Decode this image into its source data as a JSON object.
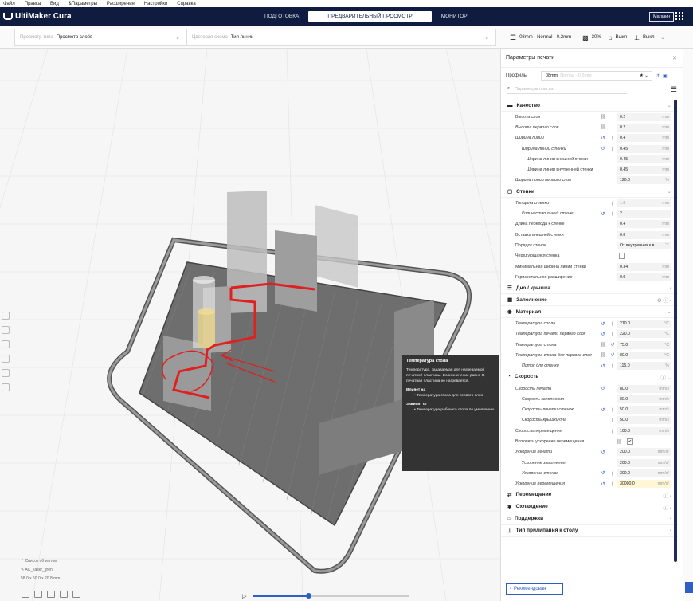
{
  "menu": [
    "Файл",
    "Правка",
    "Вид",
    "&Параметры",
    "Расширения",
    "Настройки",
    "Справка"
  ],
  "app": {
    "logo": "UltiMaker Cura"
  },
  "stages": [
    {
      "label": "ПОДГОТОВКА",
      "active": false
    },
    {
      "label": "ПРЕДВАРИТЕЛЬНЫЙ ПРОСМОТР",
      "active": true
    },
    {
      "label": "МОНИТОР",
      "active": false
    }
  ],
  "header": {
    "market": "Магазин"
  },
  "toolbar": {
    "view_type_label": "Просмотр типа",
    "view_type_value": "Просмотр слоёв",
    "color_scheme_label": "Цветовая схема",
    "color_scheme_value": "Тип линии",
    "profile_summary": "08mm - Normal - 0.2mm",
    "infill": "30%",
    "support": "Выкл",
    "adhesion": "Выкл"
  },
  "panel": {
    "title": "Параметры печати",
    "profile_label": "Профиль",
    "profile_value": "08mm",
    "profile_suffix": "Normal - 0.2mm",
    "search_placeholder": "Параметры поиска",
    "recommended_button": "Рекомендован"
  },
  "categories": {
    "quality": "Качество",
    "walls": "Стенки",
    "topbottom": "Дно / крышка",
    "infill": "Заполнение",
    "material": "Материал",
    "speed": "Скорость",
    "travel": "Перемещение",
    "cooling": "Охлаждение",
    "support": "Поддержки",
    "adhesion": "Тип прилипания к столу"
  },
  "quality_rows": [
    {
      "label": "Высота слоя",
      "value": "0.2",
      "unit": "mm"
    },
    {
      "label": "Высота первого слоя",
      "value": "0.2",
      "unit": "mm"
    },
    {
      "label": "Ширина линии",
      "value": "0.4",
      "unit": "mm"
    },
    {
      "label": "Ширина линии стенки",
      "value": "0.45",
      "unit": "mm"
    },
    {
      "label": "Ширина линии внешней стенки",
      "value": "0.45",
      "unit": "mm"
    },
    {
      "label": "Ширина линии внутренней стенки",
      "value": "0.45",
      "unit": "mm"
    },
    {
      "label": "Ширина линии первого слоя",
      "value": "120.0",
      "unit": "%"
    }
  ],
  "walls_rows": [
    {
      "label": "Толщина стенки",
      "value": "1.0",
      "unit": "mm"
    },
    {
      "label": "Количество линий стенки",
      "value": "2",
      "unit": ""
    },
    {
      "label": "Длина перехода к стенке",
      "value": "0.4",
      "unit": "mm"
    },
    {
      "label": "Вставка внешней стенки",
      "value": "0.0",
      "unit": "mm"
    },
    {
      "label": "Порядок стенок",
      "value": "От внутренних к в...",
      "unit": "﹀"
    },
    {
      "label": "Чередующаяся стенка",
      "value": "",
      "unit": ""
    },
    {
      "label": "Минимальная ширина линии стенки",
      "value": "0.34",
      "unit": "mm"
    },
    {
      "label": "Горизонтальное расширение",
      "value": "0.0",
      "unit": "mm"
    }
  ],
  "material_rows": [
    {
      "label": "Температура сопла",
      "value": "210.0",
      "unit": "°C"
    },
    {
      "label": "Температура печати первого слоя",
      "value": "220.0",
      "unit": "°C"
    },
    {
      "label": "Температура стола",
      "value": "75.0",
      "unit": "°C"
    },
    {
      "label": "Температура стола для первого слоя",
      "value": "80.0",
      "unit": "°C"
    },
    {
      "label": "Поток для стенки",
      "value": "115.0",
      "unit": "%"
    }
  ],
  "speed_rows": [
    {
      "label": "Скорость печати",
      "value": "80.0",
      "unit": "mm/s"
    },
    {
      "label": "Скорость заполнения",
      "value": "80.0",
      "unit": "mm/s"
    },
    {
      "label": "Скорость печати стенок",
      "value": "50.0",
      "unit": "mm/s"
    },
    {
      "label": "Скорость крышки/дна",
      "value": "50.0",
      "unit": "mm/s"
    },
    {
      "label": "Скорость перемещения",
      "value": "100.0",
      "unit": "mm/s"
    },
    {
      "label": "Включить ускорение перемещения",
      "value": "✔",
      "unit": ""
    },
    {
      "label": "Ускорение печати",
      "value": "200.0",
      "unit": "mm/s²"
    },
    {
      "label": "Ускорение заполнения",
      "value": "200.0",
      "unit": "mm/s²"
    },
    {
      "label": "Ускорение стенок",
      "value": "300.0",
      "unit": "mm/s²"
    },
    {
      "label": "Ускорение перемещения",
      "value": "30000.0",
      "unit": "mm/s²"
    }
  ],
  "tooltip": {
    "title": "Температура стола",
    "body": "Температура, задаваемая для нагреваемой печатной пластины. Если значение равно 0, печатная пластина не нагревается.",
    "affects_title": "Влияет на",
    "affects_item": "• Температура стола для первого слоя",
    "depends_title": "Зависит от",
    "depends_item": "• Температура рабочего стола по умолчанию"
  },
  "objects": {
    "list_label": "Список объектов",
    "name": "AC_kaskr_gren",
    "dims": "58.0 x 50.0 x 20.8 mm"
  }
}
